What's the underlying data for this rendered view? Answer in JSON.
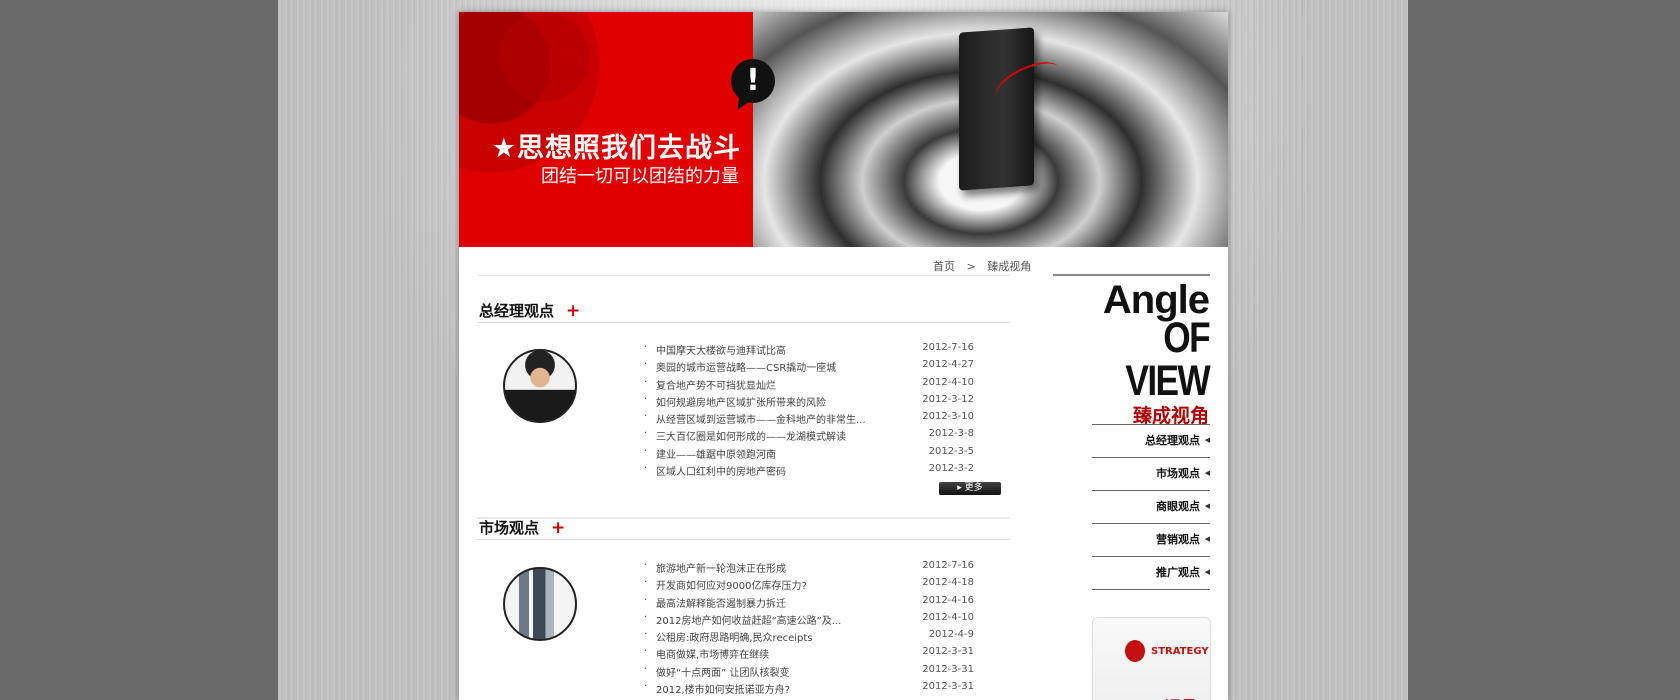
{
  "banner": {
    "slogan_main": "★思想照我们去战斗",
    "slogan_sub": "团结一切可以团结的力量",
    "bubble_mark": "!"
  },
  "breadcrumb": {
    "home": "首页",
    "separator": ">",
    "current": "臻成视角"
  },
  "sections": [
    {
      "title": "总经理观点",
      "plus": "+",
      "avatar": "avatar-person",
      "items": [
        {
          "title": "中国摩天大楼欲与迪拜试比高",
          "date": "2012-7-16"
        },
        {
          "title": "奥园的城市运营战略——CSR撬动一座城",
          "date": "2012-4-27"
        },
        {
          "title": "复合地产势不可挡犹显灿烂",
          "date": "2012-4-10"
        },
        {
          "title": "如何规避房地产区域扩张所带来的风险",
          "date": "2012-3-12"
        },
        {
          "title": "从经营区域到运营城市——金科地产的非常生...",
          "date": "2012-3-10"
        },
        {
          "title": "三大百亿圈是如何形成的——龙湖模式解读",
          "date": "2012-3-8"
        },
        {
          "title": "建业——雄踞中原领跑河南",
          "date": "2012-3-5"
        },
        {
          "title": "区域人口红利中的房地产密码",
          "date": "2012-3-2"
        }
      ],
      "more_label": "▸ 更多"
    },
    {
      "title": "市场观点",
      "plus": "+",
      "avatar": "avatar-city",
      "items": [
        {
          "title": "旅游地产新一轮泡沫正在形成",
          "date": "2012-7-16"
        },
        {
          "title": "开发商如何应对9000亿库存压力?",
          "date": "2012-4-18"
        },
        {
          "title": "最高法解释能否遏制暴力拆迁",
          "date": "2012-4-16"
        },
        {
          "title": "2012房地产如何收益赶超“高速公路”及...",
          "date": "2012-4-10"
        },
        {
          "title": "公租房:政府思路明确,民众receipts",
          "date": "2012-4-9"
        },
        {
          "title": "电商做媒,市场博弈在继续",
          "date": "2012-3-31"
        },
        {
          "title": "做好“十点两面” 让团队核裂变",
          "date": "2012-3-31"
        },
        {
          "title": "2012,楼市如何安抵诺亚方舟?",
          "date": "2012-3-31"
        }
      ]
    }
  ],
  "sidebar": {
    "angle_line1": "Angle",
    "angle_line2": "OF VIEW",
    "angle_cn": "臻成视角",
    "menu": [
      {
        "label": "总经理观点",
        "arrow": "◀"
      },
      {
        "label": "市场观点",
        "arrow": "◀"
      },
      {
        "label": "商眼观点",
        "arrow": "◀"
      },
      {
        "label": "营销观点",
        "arrow": "◀"
      },
      {
        "label": "推广观点",
        "arrow": "◀"
      }
    ],
    "strategy_label": "STRATEGY",
    "strategy_cn": "远见"
  }
}
